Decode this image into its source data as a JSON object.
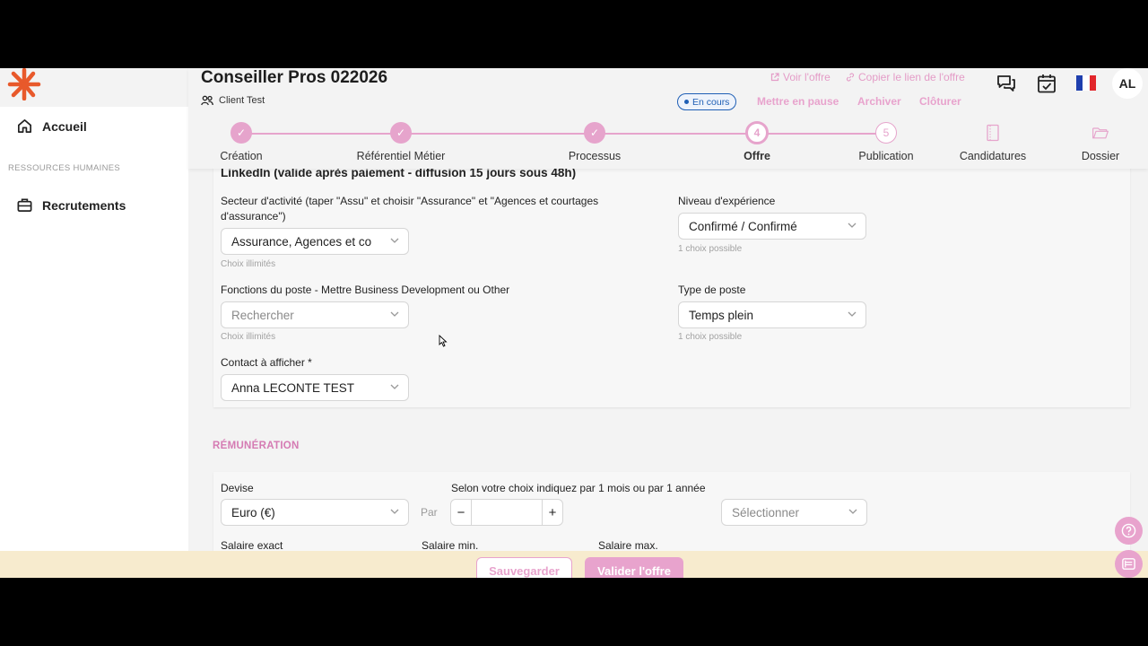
{
  "header": {
    "title": "Conseiller Pros 022026",
    "client": "Client Test",
    "view_offer": "Voir l'offre",
    "copy_link": "Copier le lien de l'offre",
    "status": "En cours",
    "pause": "Mettre en pause",
    "archive": "Archiver",
    "close": "Clôturer",
    "avatar": "AL",
    "icons": [
      "chat-icon",
      "calendar-check-icon",
      "french-flag-icon"
    ]
  },
  "sidebar": {
    "home": "Accueil",
    "section": "RESSOURCES HUMAINES",
    "recruitments": "Recrutements"
  },
  "stepper": {
    "steps": [
      {
        "label": "Création",
        "state": "done"
      },
      {
        "label": "Référentiel Métier",
        "state": "done"
      },
      {
        "label": "Processus",
        "state": "done"
      },
      {
        "label": "Offre",
        "number": "4",
        "state": "current"
      },
      {
        "label": "Publication",
        "number": "5",
        "state": "todo"
      },
      {
        "label": "Candidatures",
        "state": "icon"
      },
      {
        "label": "Dossier",
        "state": "icon"
      }
    ]
  },
  "linkedin": {
    "heading": "LinkedIn (valide après paiement - diffusion 15 jours sous 48h)",
    "sector_label": "Secteur d'activité (taper \"Assu\" et choisir \"Assurance\" et \"Agences et courtages d'assurance\")",
    "sector_value": "Assurance, Agences et co",
    "sector_hint": "Choix illimités",
    "functions_label": "Fonctions du poste - Mettre Business Development ou Other",
    "functions_placeholder": "Rechercher",
    "functions_hint": "Choix illimités",
    "contact_label": "Contact à afficher *",
    "contact_value": "Anna LECONTE TEST",
    "experience_label": "Niveau d'expérience",
    "experience_value": "Confirmé / Confirmé",
    "experience_hint": "1 choix possible",
    "post_type_label": "Type de poste",
    "post_type_value": "Temps plein",
    "post_type_hint": "1 choix possible"
  },
  "remuneration": {
    "title": "RÉMUNÉRATION",
    "currency_label": "Devise",
    "currency_value": "Euro (€)",
    "par": "Par",
    "period_label": "Selon votre choix indiquez par 1 mois ou par 1 année",
    "period_minus": "−",
    "period_plus": "+",
    "period_select_placeholder": "Sélectionner",
    "salary_exact": "Salaire exact",
    "salary_min": "Salaire min.",
    "salary_max": "Salaire max."
  },
  "footer": {
    "save": "Sauvegarder",
    "validate": "Valider l'offre"
  },
  "colors": {
    "accent_pink": "#e8a3cd",
    "brand_orange": "#e8592b",
    "status_blue": "#1f5fb5",
    "bottom_bar": "#f7ebce"
  }
}
